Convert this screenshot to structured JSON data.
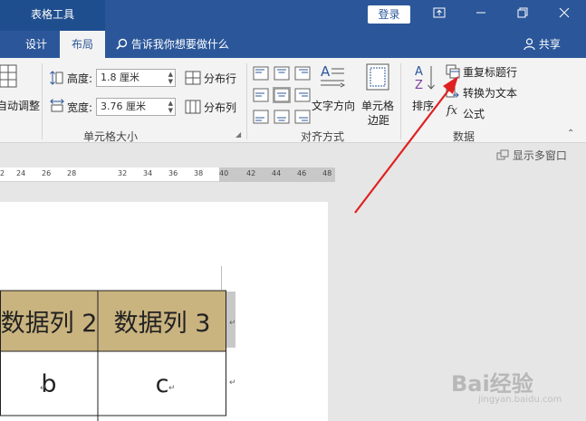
{
  "titlebar": {
    "tools_label": "表格工具",
    "login": "登录",
    "win_icons": [
      "restore-ribbon",
      "minimize",
      "restore",
      "close"
    ]
  },
  "tabs": [
    {
      "label": "设计",
      "active": false
    },
    {
      "label": "布局",
      "active": true
    }
  ],
  "tellme": "告诉我你想要做什么",
  "share": "共享",
  "ribbon": {
    "autofit": "自动调整",
    "height_label": "高度:",
    "height_value": "1.8 厘米",
    "width_label": "宽度:",
    "width_value": "3.76 厘米",
    "distribute_rows": "分布行",
    "distribute_cols": "分布列",
    "cellsize_group": "单元格大小",
    "text_direction": "文字方向",
    "cell_margins_1": "单元格",
    "cell_margins_2": "边距",
    "alignment_group": "对齐方式",
    "sort": "排序",
    "repeat_header": "重复标题行",
    "convert_text": "转换为文本",
    "formula": "公式",
    "data_group": "数据"
  },
  "multi_window": "显示多窗口",
  "ruler_ticks": [
    "2",
    "24",
    "26",
    "28",
    "32",
    "34",
    "36",
    "38",
    "40",
    "42",
    "44",
    "46",
    "48"
  ],
  "table": {
    "headers": [
      "数据列 2",
      "数据列 3"
    ],
    "row": [
      "b",
      "c"
    ]
  },
  "watermark": "Bai经验",
  "watermark_sub": "jingyan.baidu.com",
  "colors": {
    "title_blue": "#2b579a",
    "header_fill": "#c9b37f",
    "annotation_red": "#e02020"
  }
}
